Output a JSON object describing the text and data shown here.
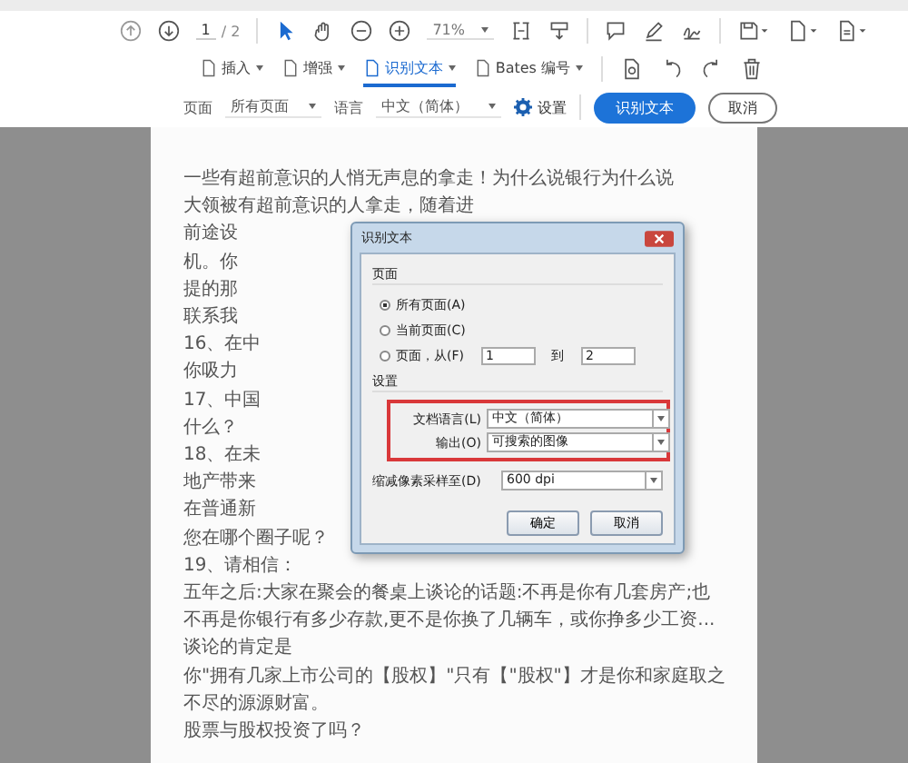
{
  "toolbar": {
    "page_current": "1",
    "page_total": "/ 2",
    "zoom": "71%"
  },
  "tool_tabs": [
    {
      "label": "插入",
      "selected": false
    },
    {
      "label": "增强",
      "selected": false
    },
    {
      "label": "识别文本",
      "selected": true
    },
    {
      "label": "Bates 编号",
      "selected": false
    }
  ],
  "options_bar": {
    "page_label": "页面",
    "page_value": "所有页面",
    "language_label": "语言",
    "language_value": "中文（简体）",
    "settings": "设置",
    "primary_button": "识别文本",
    "cancel_button": "取消"
  },
  "document": {
    "lines": [
      "一些有超前意识的人悄无声息的拿走！为什么说银行为什么说",
      "大领被有超前意识的人拿走，随着进",
      "前途设",
      "机。你",
      "提的那",
      "联系我",
      "16、在中",
      "你吸力",
      "17、中国",
      "什么？",
      "18、在未",
      "地产带来",
      "在普通新",
      "您在哪个圈子呢？",
      "19、请相信：",
      "五年之后:大家在聚会的餐桌上谈论的话题:不再是你有几套房产;也",
      "不再是你银行有多少存款,更不是你换了几辆车，或你挣多少工资...",
      "谈论的肯定是",
      "你\"拥有几家上市公司的【股权】\"只有【\"股权\"】才是你和家庭取之",
      "不尽的源源财富。",
      "股票与股权投资了吗？"
    ]
  },
  "dialog": {
    "title": "识别文本",
    "pages_section": "页面",
    "page_options": [
      {
        "label": "所有页面(A)",
        "selected": true
      },
      {
        "label": "当前页面(C)",
        "selected": false
      },
      {
        "label": "页面，从(F)",
        "selected": false
      }
    ],
    "from_value": "1",
    "to_label": "到",
    "to_value": "2",
    "settings_section": "设置",
    "fields": [
      {
        "label": "文档语言(L)",
        "value": "中文（简体）",
        "highlighted": true
      },
      {
        "label": "输出(O)",
        "value": "可搜索的图像",
        "highlighted": true
      },
      {
        "label": "缩减像素采样至(D)",
        "value": "600 dpi",
        "highlighted": false
      }
    ],
    "ok_button": "确定",
    "cancel_button": "取消"
  }
}
